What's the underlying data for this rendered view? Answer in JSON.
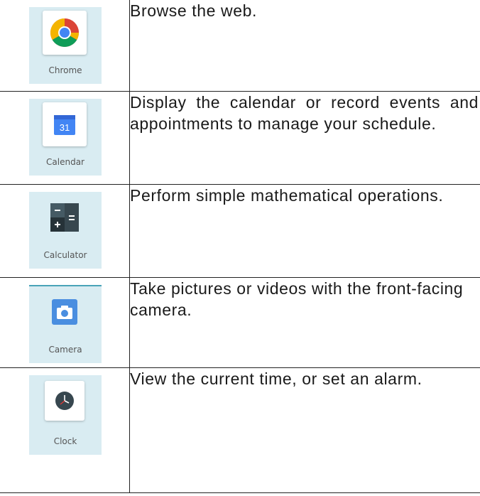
{
  "apps": [
    {
      "icon": "chrome-icon",
      "label": "Chrome",
      "description": "Browse the web."
    },
    {
      "icon": "calendar-icon",
      "label": "Calendar",
      "day": "31",
      "description": "Display the calendar or record events and appointments to manage your schedule."
    },
    {
      "icon": "calculator-icon",
      "label": "Calculator",
      "description": "Perform simple mathematical operations."
    },
    {
      "icon": "camera-icon",
      "label": "Camera",
      "description": "Take pictures or videos with the front-facing camera."
    },
    {
      "icon": "clock-icon",
      "label": "Clock",
      "description": "View the current time, or set an alarm."
    }
  ],
  "colors": {
    "tile_bg": "#d9ecf2",
    "calendar_blue": "#4285f4",
    "calculator_dark": "#37474f",
    "camera_blue": "#4a8ee0"
  }
}
